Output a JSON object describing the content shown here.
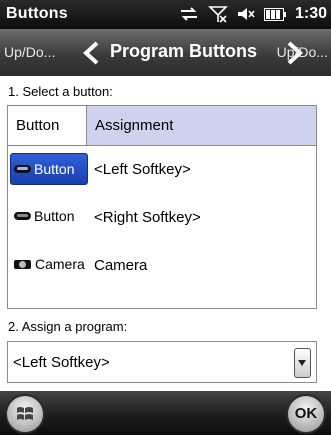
{
  "status_bar": {
    "title": "Buttons",
    "time": "1:30",
    "icons": [
      "sync-icon",
      "signal-off-icon",
      "volume-muted-icon",
      "battery-icon"
    ]
  },
  "nav": {
    "prev_label": "Up/Do...",
    "title": "Program Buttons",
    "next_label": "Up/Do..."
  },
  "section1": {
    "label": "1. Select a button:",
    "columns": [
      "Button",
      "Assignment"
    ],
    "rows": [
      {
        "button": "Button",
        "assignment": "<Left Softkey>",
        "selected": true,
        "icon": "button-icon"
      },
      {
        "button": "Button",
        "assignment": "<Right Softkey>",
        "selected": false,
        "icon": "button-icon"
      },
      {
        "button": "Camera",
        "assignment": "Camera",
        "selected": false,
        "icon": "camera-icon"
      }
    ]
  },
  "section2": {
    "label": "2. Assign a program:",
    "selected_program": "<Left Softkey>"
  },
  "bottom_bar": {
    "ok_label": "OK"
  },
  "colors": {
    "header_highlight": "#cfd2ef",
    "selection": "#2a55cf"
  }
}
